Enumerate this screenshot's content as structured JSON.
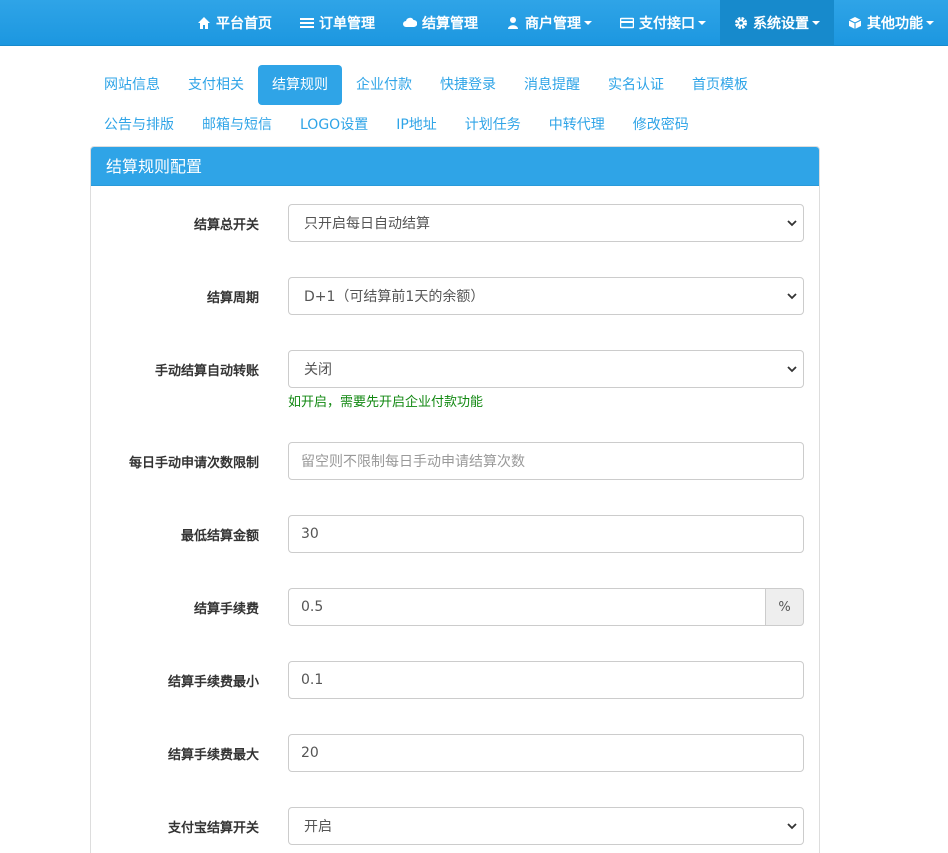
{
  "nav": {
    "items": [
      {
        "label": "平台首页",
        "icon": "home-icon"
      },
      {
        "label": "订单管理",
        "icon": "list-icon"
      },
      {
        "label": "结算管理",
        "icon": "cloud-icon"
      },
      {
        "label": "商户管理",
        "icon": "user-icon"
      },
      {
        "label": "支付接口",
        "icon": "credit-card-icon"
      },
      {
        "label": "系统设置",
        "icon": "gear-icon"
      },
      {
        "label": "其他功能",
        "icon": "cube-icon"
      }
    ]
  },
  "tabs": {
    "row1": [
      "网站信息",
      "支付相关",
      "结算规则",
      "企业付款",
      "快捷登录",
      "消息提醒",
      "实名认证",
      "首页模板"
    ],
    "row2": [
      "公告与排版",
      "邮箱与短信",
      "LOGO设置",
      "IP地址",
      "计划任务",
      "中转代理",
      "修改密码"
    ]
  },
  "panel": {
    "title": "结算规则配置"
  },
  "form": {
    "settle_switch": {
      "label": "结算总开关",
      "value": "只开启每日自动结算"
    },
    "settle_cycle": {
      "label": "结算周期",
      "value": "D+1（可结算前1天的余额）"
    },
    "auto_transfer": {
      "label": "手动结算自动转账",
      "value": "关闭",
      "help": "如开启，需要先开启企业付款功能"
    },
    "daily_limit": {
      "label": "每日手动申请次数限制",
      "placeholder": "留空则不限制每日手动申请结算次数"
    },
    "min_amount": {
      "label": "最低结算金额",
      "value": "30"
    },
    "fee": {
      "label": "结算手续费",
      "value": "0.5",
      "unit": "%"
    },
    "fee_min": {
      "label": "结算手续费最小",
      "value": "0.1"
    },
    "fee_max": {
      "label": "结算手续费最大",
      "value": "20"
    },
    "alipay_switch": {
      "label": "支付宝结算开关",
      "value": "开启"
    }
  }
}
